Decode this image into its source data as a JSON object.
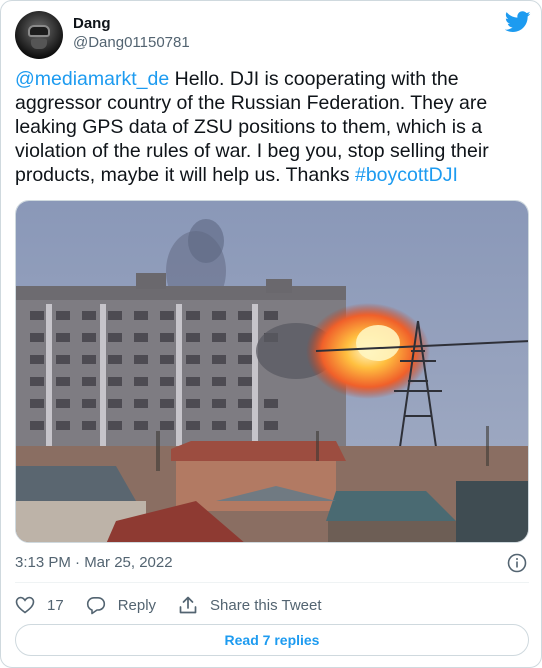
{
  "author": {
    "display_name": "Dang",
    "handle": "@Dang01150781",
    "avatar_icon": "helmet-avatar"
  },
  "brand": {
    "logo_icon": "twitter-bird-icon",
    "color": "#1d9bf0"
  },
  "tweet": {
    "mention": "@mediamarkt_de",
    "body": " Hello. DJI is cooperating with the aggressor country of the Russian Federation. They are leaking GPS data of ZSU positions to them, which is a violation of the rules of war. I beg you, stop selling their products, maybe it will help us. Thanks ",
    "hashtag": "#boycottDJI",
    "media": "photo: explosion hitting an apartment building with power line tower in foreground",
    "timestamp": "3:13 PM · Mar 25, 2022"
  },
  "actions": {
    "like_count": "17",
    "reply_label": "Reply",
    "share_label": "Share this Tweet"
  },
  "read_replies_label": "Read 7 replies",
  "colors": {
    "text": "#0f1419",
    "secondary": "#536471",
    "link": "#1d9bf0",
    "border": "#cfd9de"
  }
}
